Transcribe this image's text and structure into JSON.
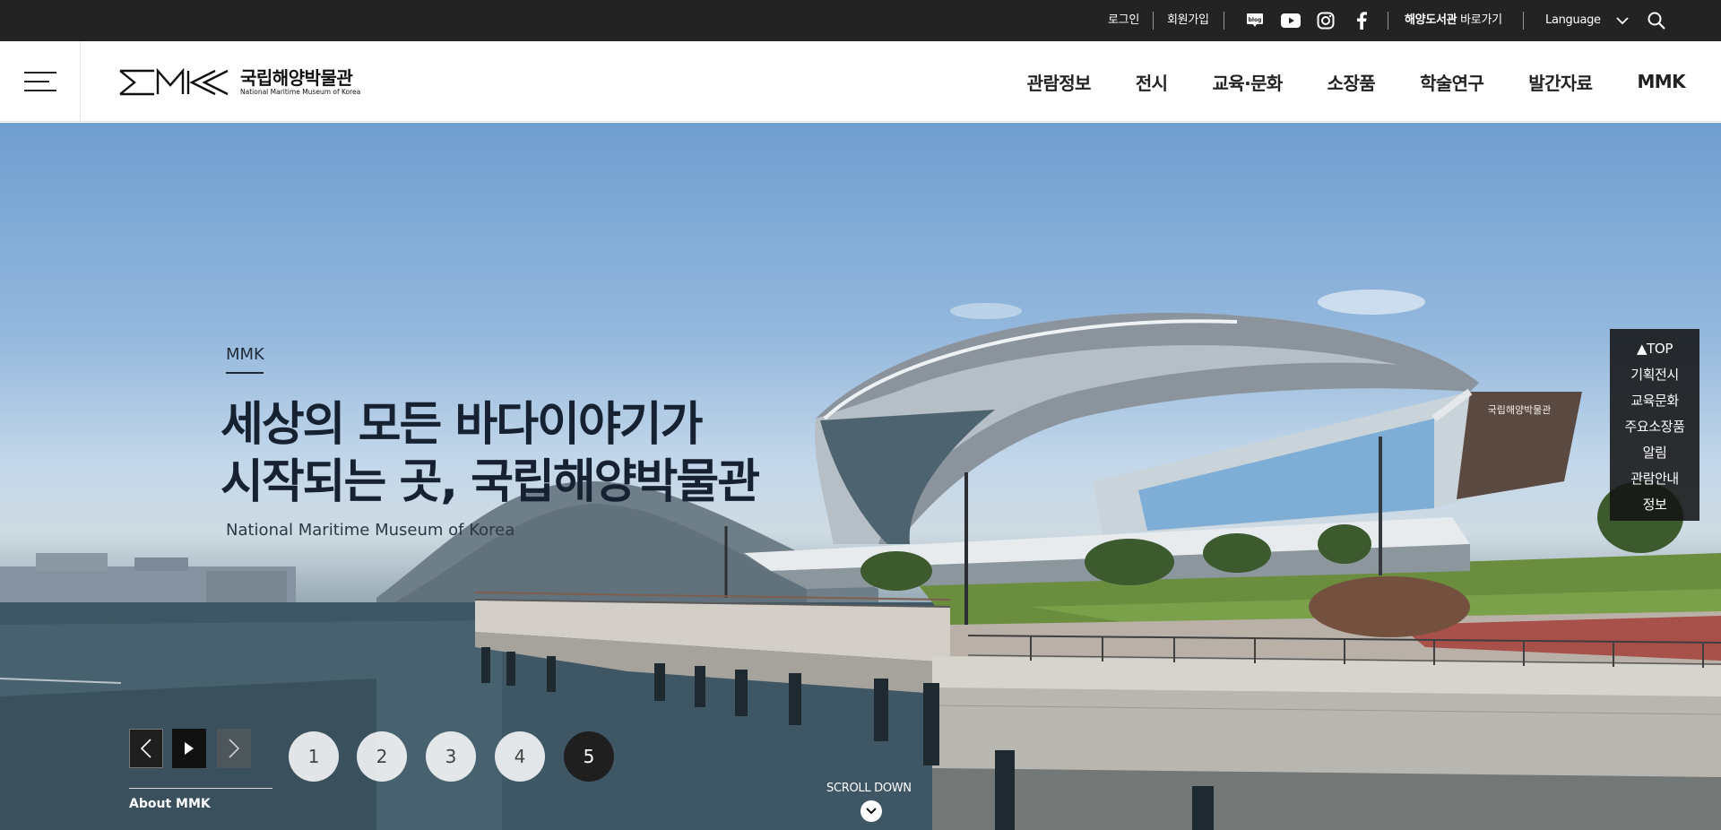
{
  "topbar": {
    "login": "로그인",
    "signup": "회원가입",
    "social": [
      "blog-icon",
      "youtube-icon",
      "instagram-icon",
      "facebook-icon"
    ],
    "library_bold": "해양도서관",
    "library_rest": " 바로가기",
    "language": "Language"
  },
  "header": {
    "logo_ko": "국립해양박물관",
    "logo_en": "National Maritime Museum of Korea",
    "nav": [
      "관람정보",
      "전시",
      "교육·문화",
      "소장품",
      "학술연구",
      "발간자료",
      "MMK"
    ]
  },
  "hero": {
    "kicker": "MMK",
    "headline_line1": "세상의 모든 바다이야기가",
    "headline_line2": "시작되는 곳, 국립해양박물관",
    "sub_en": "National Maritime Museum of Korea",
    "slides": [
      "1",
      "2",
      "3",
      "4",
      "5"
    ],
    "active_slide": 5,
    "about_link": "About MMK",
    "scroll_down": "SCROLL DOWN",
    "building_sign": "국립해양박물관"
  },
  "quick_menu": {
    "top": "▲TOP",
    "items": [
      "기획전시",
      "교육문화",
      "주요소장품",
      "알림",
      "관람안내",
      "정보"
    ]
  },
  "colors": {
    "topbar_bg": "#232323",
    "headline": "#162231",
    "active_dot": "#1f1f1f"
  }
}
